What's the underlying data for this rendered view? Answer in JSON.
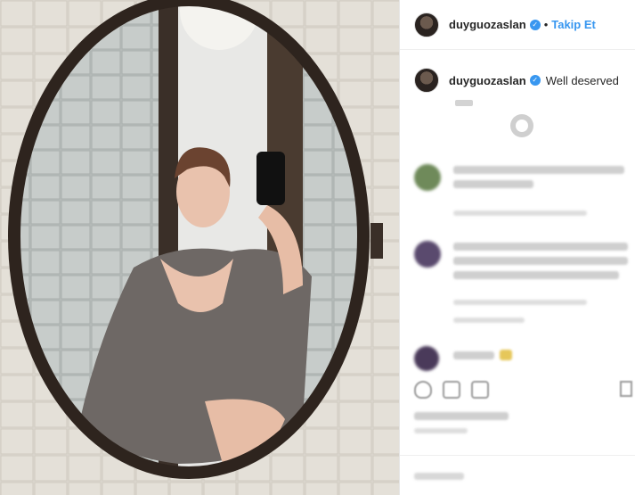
{
  "header": {
    "username": "duyguozaslan",
    "separator": "•",
    "follow_label": "Takip Et"
  },
  "caption": {
    "username": "duyguozaslan",
    "text": "Well deserved"
  },
  "colors": {
    "link_blue": "#3897f0",
    "verified_blue": "#3897f0",
    "text_dark": "#262626",
    "blur_gray": "#cfcfcf"
  },
  "icons": [
    "verified-badge-icon",
    "load-more-icon",
    "like-icon",
    "comment-icon",
    "share-icon",
    "bookmark-icon"
  ]
}
